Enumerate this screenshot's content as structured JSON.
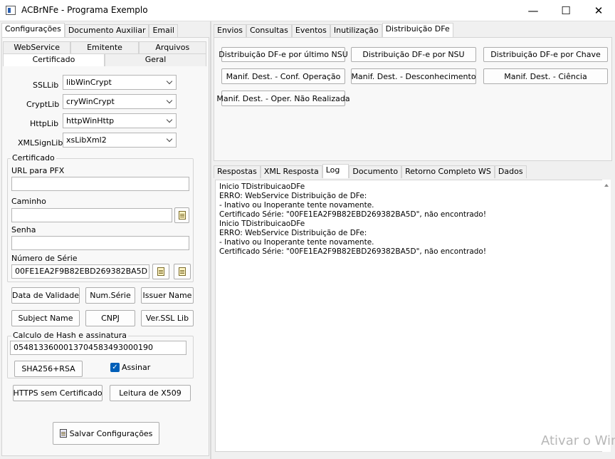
{
  "window": {
    "title": "ACBrNFe - Programa Exemplo",
    "minimize_glyph": "—",
    "maximize_glyph": "☐",
    "close_glyph": "✕"
  },
  "left_tabs": [
    "Configurações",
    "Documento Auxiliar",
    "Email"
  ],
  "config_tabs_row1": [
    "WebService",
    "Emitente",
    "Arquivos"
  ],
  "config_tabs_row2": [
    "Certificado",
    "Geral"
  ],
  "certificado": {
    "ssllib_label": "SSLLib",
    "ssllib_value": "libWinCrypt",
    "cryptlib_label": "CryptLib",
    "cryptlib_value": "cryWinCrypt",
    "httplib_label": "HttpLib",
    "httplib_value": "httpWinHttp",
    "xmlsignlib_label": "XMLSignLib",
    "xmlsignlib_value": "xsLibXml2",
    "group_title": "Certificado",
    "url_pfx_label": "URL para PFX",
    "url_pfx_value": "",
    "caminho_label": "Caminho",
    "caminho_value": "",
    "senha_label": "Senha",
    "senha_value": "",
    "numero_serie_label": "Número de Série",
    "numero_serie_value": "00FE1EA2F9B82EBD269382BA5D",
    "btn_data_validade": "Data de Validade",
    "btn_num_serie": "Num.Série",
    "btn_issuer_name": "Issuer Name",
    "btn_subject_name": "Subject Name",
    "btn_cnpj": "CNPJ",
    "btn_ver_ssl_lib": "Ver.SSL Lib",
    "hash_group_title": "Calculo de Hash e assinatura",
    "hash_value": "05481336000137045834930001​90",
    "btn_sha256": "SHA256+RSA",
    "assinar_label": "Assinar",
    "assinar_checked": true,
    "btn_https_sem_cert": "HTTPS sem Certificado",
    "btn_leitura_x509": "Leitura de X509",
    "btn_salvar": "Salvar Configurações"
  },
  "right_tabs": [
    "Envios",
    "Consultas",
    "Eventos",
    "Inutilização",
    "Distribuição DFe"
  ],
  "dfe_buttons": {
    "ultimo_nsu": "Distribuição DF-e por último NSU",
    "por_nsu": "Distribuição DF-e por NSU",
    "por_chave": "Distribuição DF-e por Chave",
    "conf_operacao": "Manif. Dest. - Conf. Operação",
    "desconhecimento": "Manif. Dest. - Desconhecimento",
    "ciencia": "Manif. Dest. - Ciência",
    "oper_nao_realizada": "Manif. Dest. - Oper. Não Realizada"
  },
  "bottom_tabs": [
    "Respostas",
    "XML Resposta",
    "Log",
    "Documento",
    "Retorno Completo WS",
    "Dados"
  ],
  "log_text": "Inicio TDistribuicaoDFe\nERRO: WebService Distribuição de DFe:\n- Inativo ou Inoperante tente novamente.\nCertificado Série: \"00FE1EA2F9B82EBD269382BA5D\", não encontrado!\nInicio TDistribuicaoDFe\nERRO: WebService Distribuição de DFe:\n- Inativo ou Inoperante tente novamente.\nCertificado Série: \"00FE1EA2F9B82EBD269382BA5D\", não encontrado!",
  "watermark": "Ativar o Win"
}
